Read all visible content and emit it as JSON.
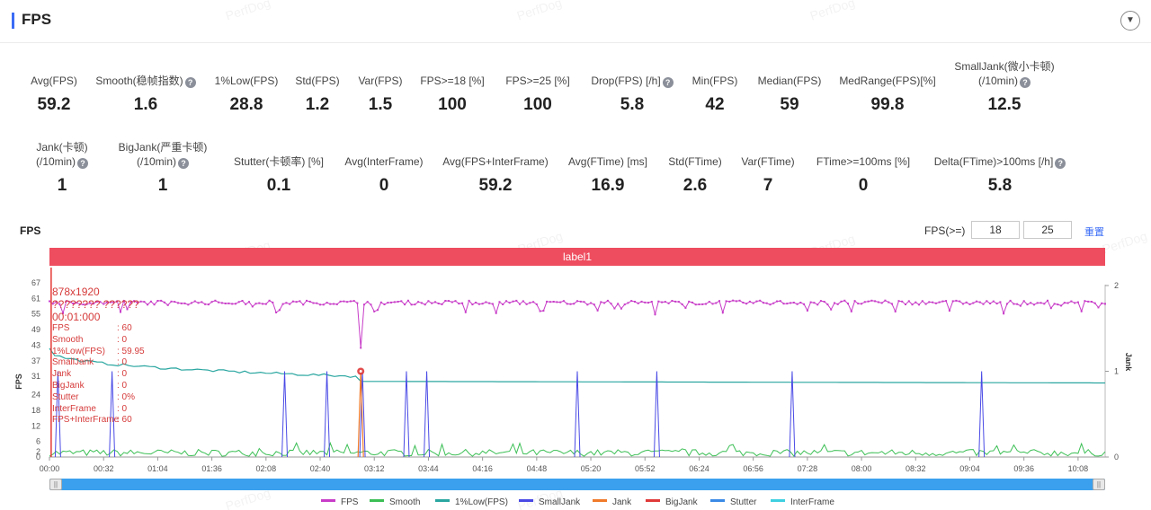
{
  "header": {
    "title": "FPS",
    "collapse_icon": "chevron-down-icon",
    "accent_color": "#3b6cf6"
  },
  "metrics_row1": [
    {
      "label": "Avg(FPS)",
      "value": "59.2",
      "help": false
    },
    {
      "label": "Smooth(稳帧指数)",
      "value": "1.6",
      "help": true
    },
    {
      "label": "1%Low(FPS)",
      "value": "28.8",
      "help": false
    },
    {
      "label": "Std(FPS)",
      "value": "1.2",
      "help": false
    },
    {
      "label": "Var(FPS)",
      "value": "1.5",
      "help": false
    },
    {
      "label": "FPS>=18 [%]",
      "value": "100",
      "help": false
    },
    {
      "label": "FPS>=25 [%]",
      "value": "100",
      "help": false
    },
    {
      "label": "Drop(FPS) [/h]",
      "value": "5.8",
      "help": true
    },
    {
      "label": "Min(FPS)",
      "value": "42",
      "help": false
    },
    {
      "label": "Median(FPS)",
      "value": "59",
      "help": false
    },
    {
      "label": "MedRange(FPS)[%]",
      "value": "99.8",
      "help": false
    },
    {
      "label": "SmallJank(微小卡顿)",
      "label2": "(/10min)",
      "value": "12.5",
      "help": true
    }
  ],
  "metrics_row2": [
    {
      "label": "Jank(卡顿)",
      "label2": "(/10min)",
      "value": "1",
      "help": true
    },
    {
      "label": "BigJank(严重卡顿)",
      "label2": "(/10min)",
      "value": "1",
      "help": true
    },
    {
      "label": "Stutter(卡顿率) [%]",
      "value": "0.1",
      "help": false
    },
    {
      "label": "Avg(InterFrame)",
      "value": "0",
      "help": false
    },
    {
      "label": "Avg(FPS+InterFrame)",
      "value": "59.2",
      "help": false
    },
    {
      "label": "Avg(FTime) [ms]",
      "value": "16.9",
      "help": false
    },
    {
      "label": "Std(FTime)",
      "value": "2.6",
      "help": false
    },
    {
      "label": "Var(FTime)",
      "value": "7",
      "help": false
    },
    {
      "label": "FTime>=100ms [%]",
      "value": "0",
      "help": false
    },
    {
      "label": "Delta(FTime)>100ms [/h]",
      "value": "5.8",
      "help": true
    }
  ],
  "chart_section": {
    "title": "FPS",
    "threshold_label": "FPS(>=)",
    "threshold_low": "18",
    "threshold_high": "25",
    "reset_label": "重置",
    "label_banner": "label1",
    "banner_color": "#ee4d5f"
  },
  "tooltip": {
    "resolution": "878x1920",
    "obscured_line": "???????? ??????",
    "time": "00:01:000",
    "rows": [
      {
        "key": "FPS",
        "value": ": 60"
      },
      {
        "key": "Smooth",
        "value": ": 0"
      },
      {
        "key": "1%Low(FPS)",
        "value": ": 59.95"
      },
      {
        "key": "SmallJank",
        "value": ": 0"
      },
      {
        "key": "Jank",
        "value": ": 0"
      },
      {
        "key": "BigJank",
        "value": ": 0"
      },
      {
        "key": "Stutter",
        "value": ": 0%"
      },
      {
        "key": "InterFrame",
        "value": ": 0"
      },
      {
        "key": "FPS+InterFrame",
        "value": ": 60"
      }
    ]
  },
  "watermark": "PerfDog",
  "chart_data": {
    "type": "line",
    "y_left": {
      "label": "FPS",
      "ticks": [
        "0",
        "2",
        "6",
        "12",
        "18",
        "24",
        "31",
        "37",
        "43",
        "49",
        "55",
        "61",
        "67"
      ],
      "range": [
        0,
        67
      ]
    },
    "y_right": {
      "label": "Jank",
      "ticks": [
        "0",
        "1",
        "2"
      ],
      "range": [
        0,
        2
      ]
    },
    "x_ticks": [
      "00:00",
      "00:32",
      "01:04",
      "01:36",
      "02:08",
      "02:40",
      "03:12",
      "03:44",
      "04:16",
      "04:48",
      "05:20",
      "05:52",
      "06:24",
      "06:56",
      "07:28",
      "08:00",
      "08:32",
      "09:04",
      "09:36",
      "10:08"
    ],
    "x_range_seconds": [
      0,
      624
    ],
    "series": [
      {
        "name": "FPS",
        "color": "#c83cc8",
        "typical": 59.2,
        "min": 42,
        "min_at_sec": 184
      },
      {
        "name": "Smooth",
        "color": "#3cbf55",
        "typical": 1.6
      },
      {
        "name": "1%Low(FPS)",
        "color": "#2aa6a0",
        "start": 42,
        "end": 28.8
      },
      {
        "name": "SmallJank",
        "color": "#4a4ae6",
        "spikes_sec": [
          5,
          37,
          139,
          164,
          185,
          211,
          223,
          312,
          359,
          439,
          551
        ]
      },
      {
        "name": "Jank",
        "color": "#f07a2a",
        "spikes_sec": [
          184
        ]
      },
      {
        "name": "BigJank",
        "color": "#e03a3a",
        "spikes_sec": [
          184
        ]
      },
      {
        "name": "Stutter",
        "color": "#3a8ae6"
      },
      {
        "name": "InterFrame",
        "color": "#3fd0e0"
      }
    ]
  },
  "legend": [
    {
      "name": "FPS",
      "color": "#c83cc8"
    },
    {
      "name": "Smooth",
      "color": "#3cbf55"
    },
    {
      "name": "1%Low(FPS)",
      "color": "#2aa6a0"
    },
    {
      "name": "SmallJank",
      "color": "#4a4ae6"
    },
    {
      "name": "Jank",
      "color": "#f07a2a"
    },
    {
      "name": "BigJank",
      "color": "#e03a3a"
    },
    {
      "name": "Stutter",
      "color": "#3a8ae6"
    },
    {
      "name": "InterFrame",
      "color": "#3fd0e0"
    }
  ]
}
